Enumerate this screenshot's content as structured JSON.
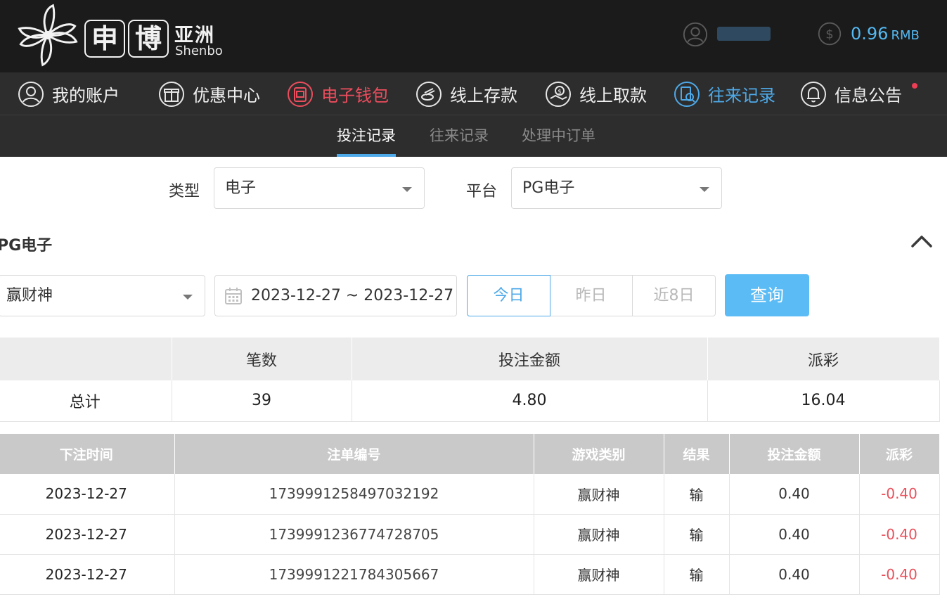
{
  "logo": {
    "char1": "申",
    "char2": "博",
    "cn": "亚洲",
    "en": "Shenbo"
  },
  "user": {
    "balance": "0.96",
    "currency": "RMB"
  },
  "nav": {
    "account": "我的账户",
    "promotions": "优惠中心",
    "wallet": "电子钱包",
    "deposit": "线上存款",
    "withdraw": "线上取款",
    "records": "往来记录",
    "notices": "信息公告"
  },
  "subnav": {
    "bet_records": "投注记录",
    "transactions": "往来记录",
    "pending_orders": "处理中订单"
  },
  "filters": {
    "type_label": "类型",
    "type_value": "电子",
    "platform_label": "平台",
    "platform_value": "PG电子",
    "section_title": "PG电子",
    "game_value": "赢财神",
    "date_range": "2023-12-27 ~ 2023-12-27",
    "today": "今日",
    "yesterday": "昨日",
    "last8": "近8日",
    "query": "查询"
  },
  "summary": {
    "headers": [
      "",
      "笔数",
      "投注金额",
      "派彩"
    ],
    "row": [
      "总计",
      "39",
      "4.80",
      "16.04"
    ]
  },
  "records": {
    "headers": [
      "下注时间",
      "注单编号",
      "游戏类别",
      "结果",
      "投注金额",
      "派彩"
    ],
    "rows": [
      [
        "2023-12-27",
        "1739991258497032192",
        "赢财神",
        "输",
        "0.40",
        "-0.40"
      ],
      [
        "2023-12-27",
        "1739991236774728705",
        "赢财神",
        "输",
        "0.40",
        "-0.40"
      ],
      [
        "2023-12-27",
        "1739991221784305667",
        "赢财神",
        "输",
        "0.40",
        "-0.40"
      ]
    ]
  },
  "colors": {
    "accent_blue": "#4ea9e8",
    "accent_red": "#ec4d5d",
    "header_bg": "#1b1b1b",
    "nav_bg": "#2d2d2d",
    "button_blue": "#5bbcf5",
    "negative": "#e8505b"
  }
}
